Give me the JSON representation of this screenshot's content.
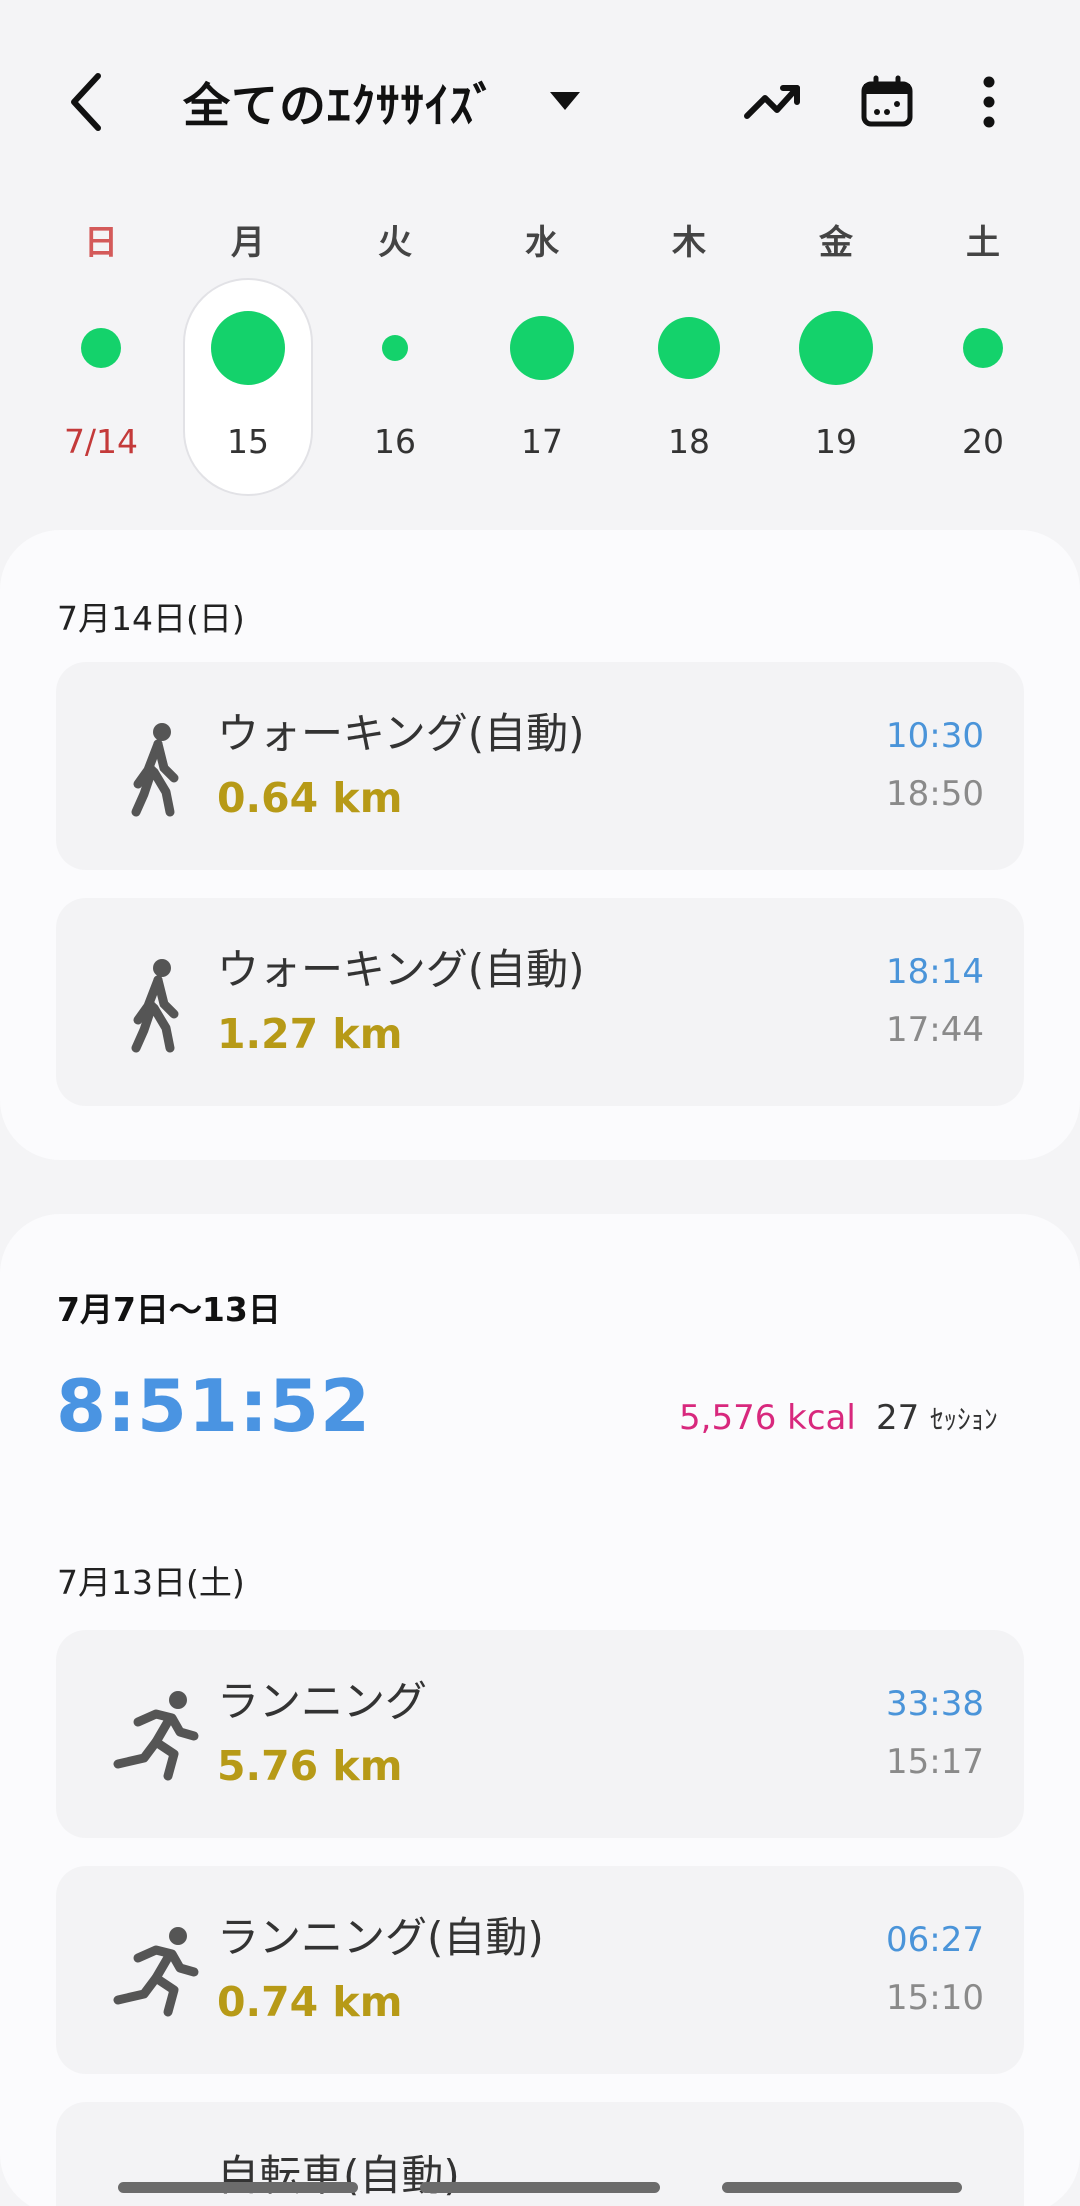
{
  "header": {
    "title": "全てのｴｸｻｻｲｽﾞ",
    "back_icon": "chevron-left-icon",
    "trend_icon": "trending-up-icon",
    "calendar_icon": "calendar-icon",
    "more_icon": "more-vertical-icon"
  },
  "week": {
    "days": [
      {
        "name": "日",
        "num": "7/14",
        "dot_size": 40,
        "sunday": true
      },
      {
        "name": "月",
        "num": "15",
        "dot_size": 74,
        "selected": true
      },
      {
        "name": "火",
        "num": "16",
        "dot_size": 26
      },
      {
        "name": "水",
        "num": "17",
        "dot_size": 64
      },
      {
        "name": "木",
        "num": "18",
        "dot_size": 62
      },
      {
        "name": "金",
        "num": "19",
        "dot_size": 74
      },
      {
        "name": "土",
        "num": "20",
        "dot_size": 40
      }
    ],
    "dot_color": "#14d26b"
  },
  "today": {
    "date": "7月14日(日)",
    "items": [
      {
        "name": "ウォーキング(自動)",
        "distance": "0.64 km",
        "duration": "10:30",
        "time": "18:50",
        "icon": "walking-icon"
      },
      {
        "name": "ウォーキング(自動)",
        "distance": "1.27 km",
        "duration": "18:14",
        "time": "17:44",
        "icon": "walking-icon"
      }
    ]
  },
  "week_summary": {
    "range": "7月7日～13日",
    "total_time": "8:51:52",
    "kcal": "5,576 kcal",
    "sessions_count": "27",
    "sessions_unit": "ｾｯｼｮﾝ",
    "date": "7月13日(土)",
    "items": [
      {
        "name": "ランニング",
        "distance": "5.76 km",
        "duration": "33:38",
        "time": "15:17",
        "icon": "running-icon"
      },
      {
        "name": "ランニング(自動)",
        "distance": "0.74 km",
        "duration": "06:27",
        "time": "15:10",
        "icon": "running-icon"
      }
    ],
    "partial_item": {
      "name": "自転車(自動)"
    }
  },
  "colors": {
    "accent_blue": "#4a94e2",
    "distance": "#b79a17",
    "kcal": "#d8287d",
    "sunday": "#c43a3a"
  }
}
